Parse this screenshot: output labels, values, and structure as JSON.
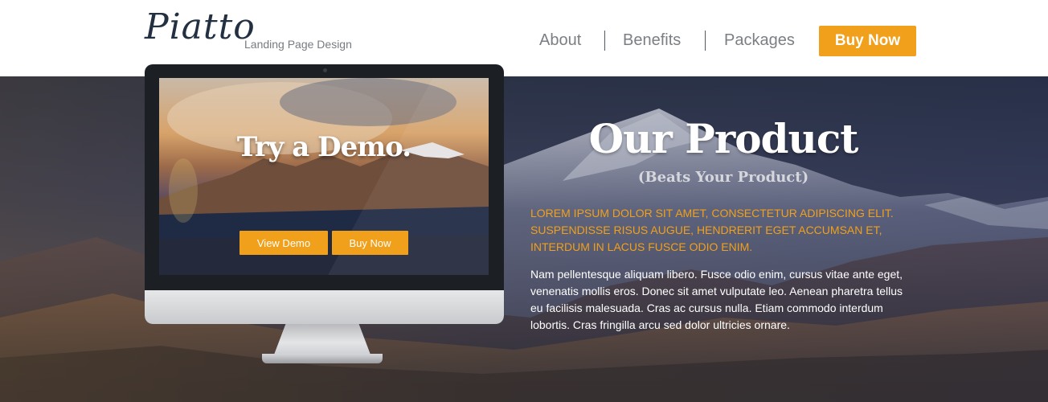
{
  "brand": {
    "logo": "Piatto",
    "tagline": "Landing Page Design"
  },
  "nav": {
    "items": [
      "About",
      "Benefits",
      "Packages"
    ],
    "cta": "Buy Now"
  },
  "demo": {
    "title": "Try a Demo.",
    "view_button": "View Demo",
    "buy_button": "Buy Now"
  },
  "product": {
    "title": "Our Product",
    "subtitle": "(Beats Your Product)",
    "lead": "LOREM IPSUM DOLOR SIT AMET, CONSECTETUR ADIPISCING ELIT. SUSPENDISSE RISUS AUGUE, HENDRERIT EGET ACCUMSAN ET, INTERDUM IN LACUS FUSCE ODIO ENIM.",
    "body": "Nam pellentesque aliquam libero. Fusce odio enim, cursus vitae ante eget, venenatis mollis eros. Donec sit amet vulputate leo. Aenean pharetra tellus eu facilisis malesuada. Cras ac cursus nulla. Etiam commodo interdum lobortis. Cras fringilla arcu sed dolor ultricies ornare."
  },
  "colors": {
    "accent": "#f0a01a",
    "logo": "#233042",
    "nav_text": "#7b7f84"
  }
}
